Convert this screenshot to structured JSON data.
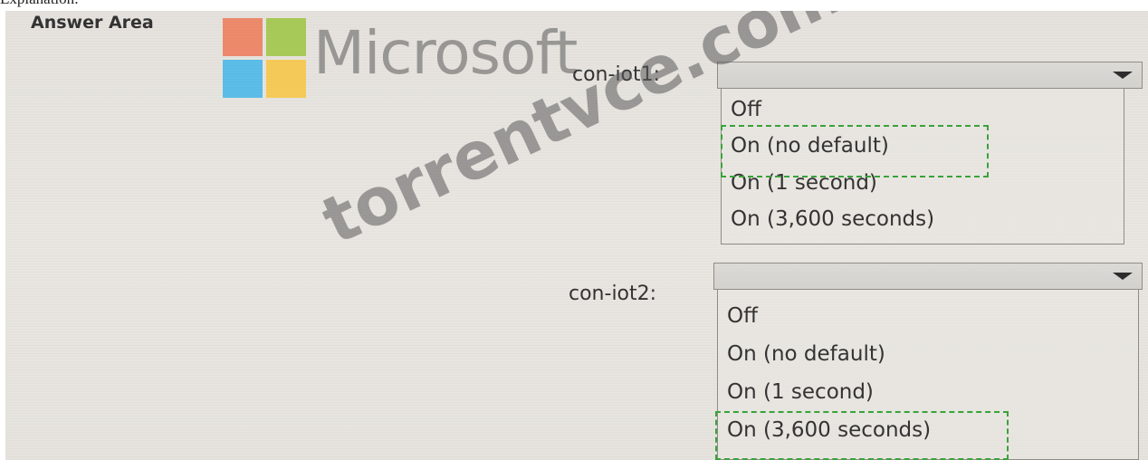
{
  "header": {
    "explanation_label": "Explanation:"
  },
  "answer_area": {
    "title": "Answer Area"
  },
  "logo": {
    "wordmark": "Microsoft",
    "colors": [
      "#f25022",
      "#7fba00",
      "#00a4ef",
      "#ffb900"
    ]
  },
  "dropdowns": [
    {
      "label": "con-iot1:",
      "selected": "",
      "options": [
        "Off",
        "On (no default)",
        "On (1 second)",
        "On (3,600 seconds)"
      ],
      "highlighted_option": "On (no default)"
    },
    {
      "label": "con-iot2:",
      "selected": "",
      "options": [
        "Off",
        "On (no default)",
        "On (1 second)",
        "On (3,600 seconds)"
      ],
      "highlighted_option": "On (3,600 seconds)"
    }
  ],
  "watermark": {
    "text": "torrentvce.com"
  },
  "colors": {
    "highlight": "#3aa23a",
    "panel_background": "#e7e4df"
  }
}
